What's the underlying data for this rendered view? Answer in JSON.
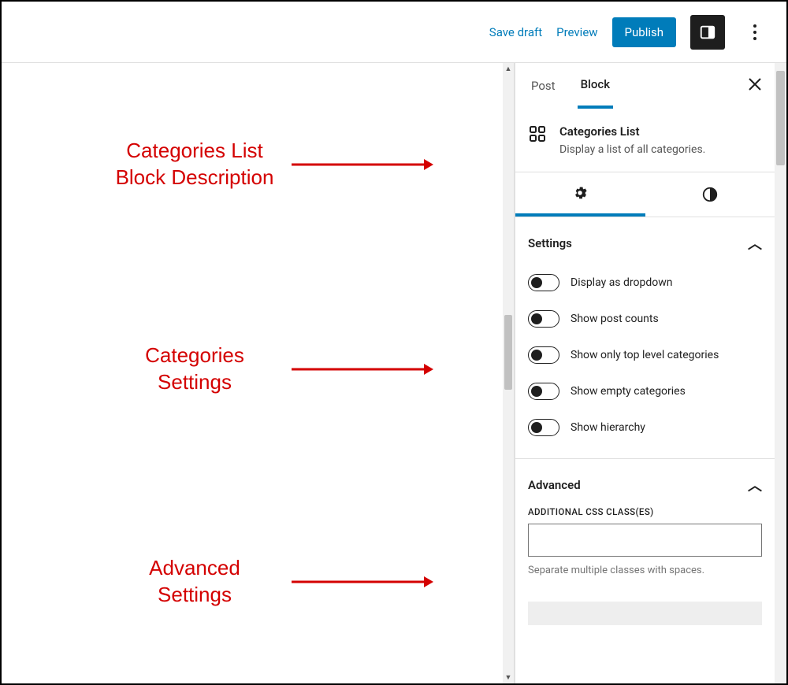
{
  "topbar": {
    "save_draft": "Save draft",
    "preview": "Preview",
    "publish": "Publish"
  },
  "panel": {
    "tab_post": "Post",
    "tab_block": "Block",
    "block_title": "Categories List",
    "block_desc": "Display a list of all categories.",
    "settings_heading": "Settings",
    "toggles": {
      "dropdown": "Display as dropdown",
      "post_counts": "Show post counts",
      "top_level": "Show only top level categories",
      "empty": "Show empty categories",
      "hierarchy": "Show hierarchy"
    },
    "advanced_heading": "Advanced",
    "advanced_field_label": "ADDITIONAL CSS CLASS(ES)",
    "advanced_help": "Separate multiple classes with spaces.",
    "advanced_value": ""
  },
  "annotations": {
    "a1_line1": "Categories List",
    "a1_line2": "Block Description",
    "a2_line1": "Categories",
    "a2_line2": "Settings",
    "a3_line1": "Advanced",
    "a3_line2": "Settings"
  }
}
